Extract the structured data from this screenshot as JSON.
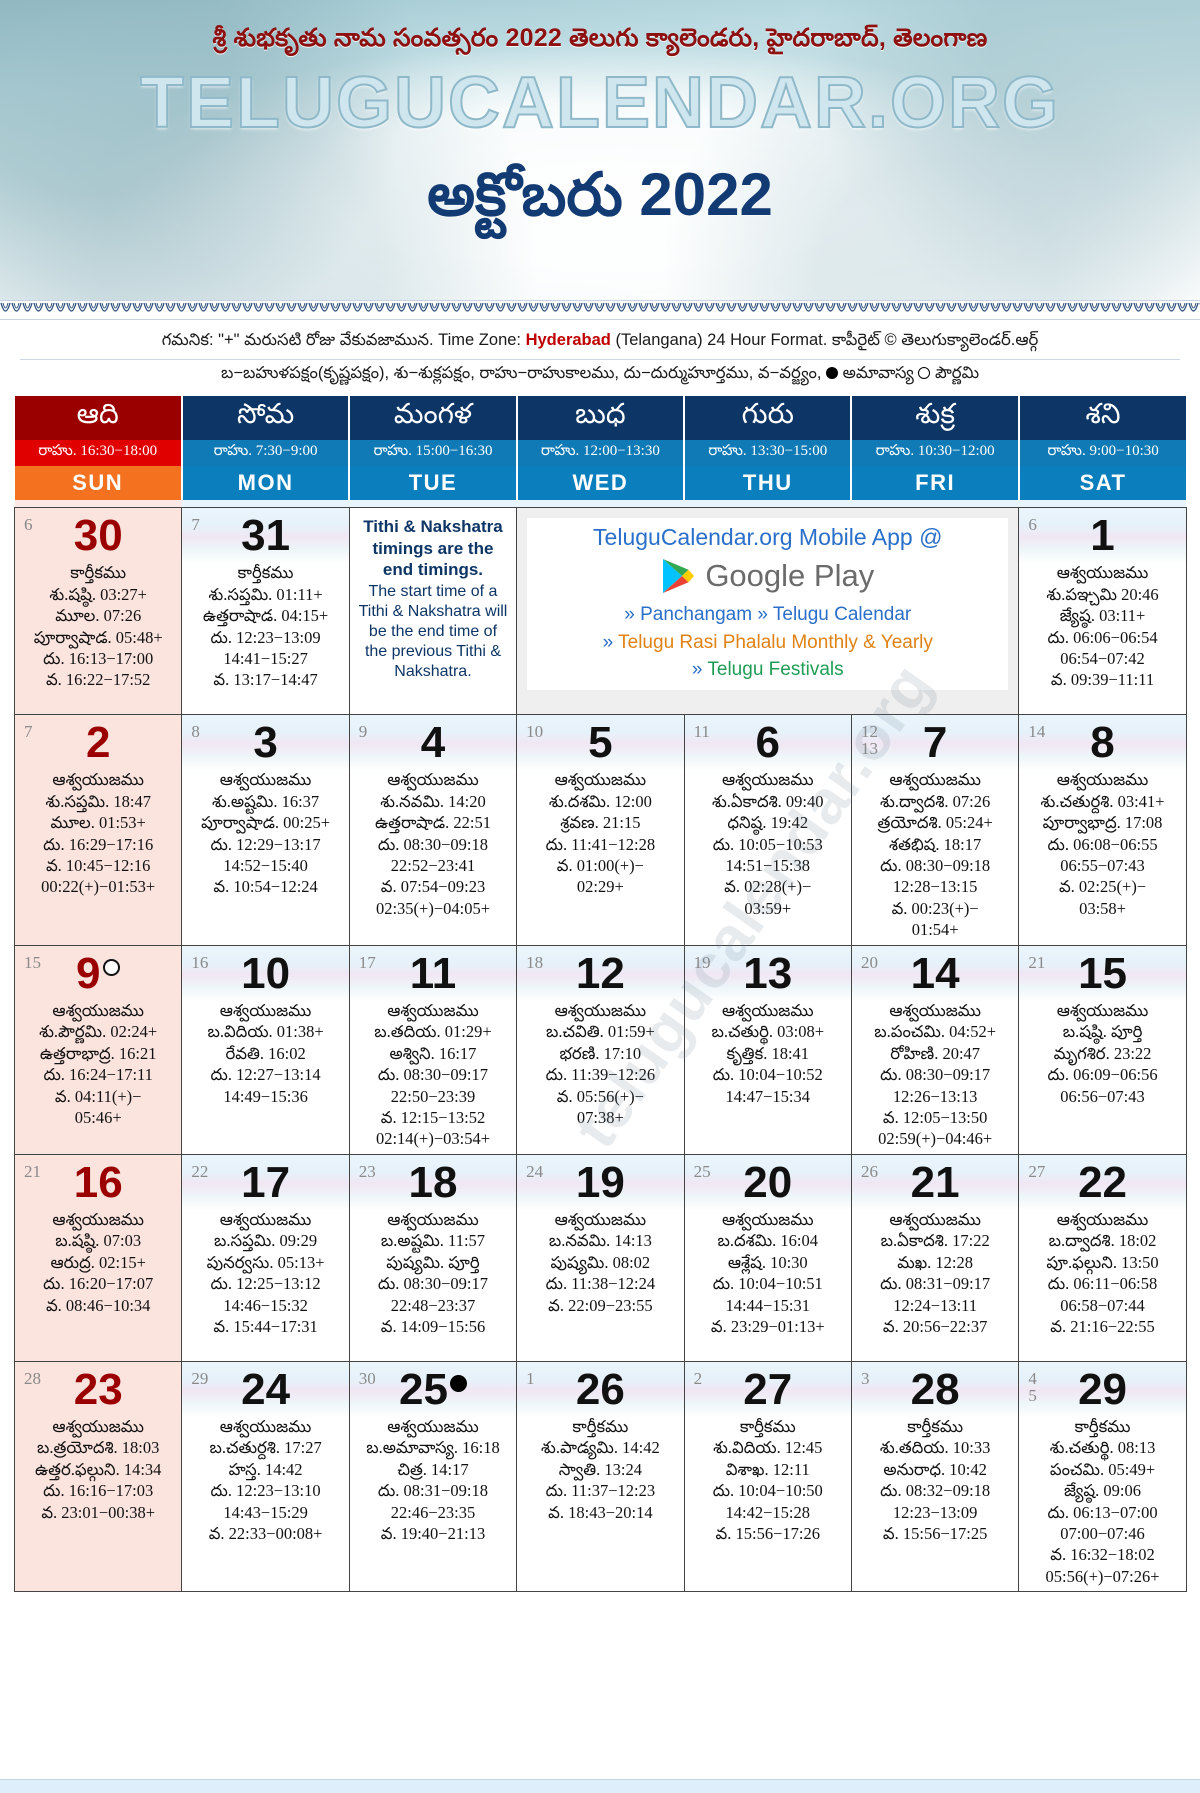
{
  "header": {
    "title": "శ్రీ శుభకృతు నామ సంవత్సరం 2022 తెలుగు క్యాలెండరు, హైదరాబాద్, తెలంగాణ",
    "logo": "TELUGUCALENDAR.ORG",
    "month_title": "అక్టోబరు 2022"
  },
  "notes": {
    "prefix": "గమనిక: \"+\" మరుసటి రోజు వేకువజామున.  Time Zone: ",
    "timezone": "Hyderabad",
    "suffix": " (Telangana) 24 Hour Format. కాపీరైట్ © తెలుగుక్యాలెండర్.ఆర్గ్",
    "legend_a": "బ−బహుళపక్షం(కృష్ణపక్షం),  శు−శుక్లపక్షం,  రాహు−రాహుకాలము,  దు−దుర్ముహూర్తము,  వ−వర్జ్యం, ",
    "legend_amavasya": " అమావాస్య ",
    "legend_pournami": " పౌర్ణమి"
  },
  "weekdays": [
    {
      "te": "ఆది",
      "rahu": "రాహు. 16:30−18:00",
      "abbr": "SUN"
    },
    {
      "te": "సోమ",
      "rahu": "రాహు. 7:30−9:00",
      "abbr": "MON"
    },
    {
      "te": "మంగళ",
      "rahu": "రాహు. 15:00−16:30",
      "abbr": "TUE"
    },
    {
      "te": "బుధ",
      "rahu": "రాహు. 12:00−13:30",
      "abbr": "WED"
    },
    {
      "te": "గురు",
      "rahu": "రాహు. 13:30−15:00",
      "abbr": "THU"
    },
    {
      "te": "శుక్ర",
      "rahu": "రాహు. 10:30−12:00",
      "abbr": "FRI"
    },
    {
      "te": "శని",
      "rahu": "రాహు. 9:00−10:30",
      "abbr": "SAT"
    }
  ],
  "tithi_note": {
    "bold": "Tithi & Nakshatra timings are the end timings.",
    "regular": "The start time of a Tithi & Nakshatra will be the end time of the previous Tithi & Nakshatra."
  },
  "promo": {
    "title": "TeluguCalendar.org Mobile App @",
    "store": "Google Play",
    "link1": "Panchangam",
    "link2": "Telugu Calendar",
    "link3": "Telugu Rasi Phalalu Monthly & Yearly",
    "link4": "Telugu Festivals",
    "arrow": "»"
  },
  "watermark_text": "telugucalendar.org",
  "calendar": {
    "weeks": [
      [
        {
          "lunar": [
            "6"
          ],
          "day": "30",
          "sunday": true,
          "lines": [
            "కార్తీకము",
            "శు.షష్ఠి. 03:27+",
            "మూల. 07:26",
            "పూర్వాషాడ. 05:48+",
            "దు. 16:13−17:00",
            "వ. 16:22−17:52"
          ]
        },
        {
          "lunar": [
            "7"
          ],
          "day": "31",
          "lines": [
            "కార్తీకము",
            "శు.సప్తమి. 01:11+",
            "ఉత్తరాషాడ. 04:15+",
            "దు. 12:23−13:09",
            "14:41−15:27",
            "వ. 13:17−14:47"
          ]
        },
        {
          "type": "note"
        },
        {
          "type": "promo"
        },
        {
          "type": "skip"
        },
        {
          "type": "skip"
        },
        {
          "lunar": [
            "6"
          ],
          "day": "1",
          "lines": [
            "ఆశ్వయుజము",
            "శు.పఞ్చమి 20:46",
            "జ్యేష్ఠ. 03:11+",
            "దు. 06:06−06:54",
            "06:54−07:42",
            "వ. 09:39−11:11"
          ]
        }
      ],
      [
        {
          "lunar": [
            "7"
          ],
          "day": "2",
          "sunday": true,
          "lines": [
            "ఆశ్వయుజము",
            "శు.సప్తమి. 18:47",
            "మూల. 01:53+",
            "దు. 16:29−17:16",
            "వ. 10:45−12:16",
            "00:22(+)−01:53+"
          ]
        },
        {
          "lunar": [
            "8"
          ],
          "day": "3",
          "lines": [
            "ఆశ్వయుజము",
            "శు.అష్టమి. 16:37",
            "పూర్వాషాడ. 00:25+",
            "దు. 12:29−13:17",
            "14:52−15:40",
            "వ. 10:54−12:24"
          ]
        },
        {
          "lunar": [
            "9"
          ],
          "day": "4",
          "lines": [
            "ఆశ్వయుజము",
            "శు.నవమి. 14:20",
            "ఉత్తరాషాడ. 22:51",
            "దు. 08:30−09:18",
            "22:52−23:41",
            "వ. 07:54−09:23",
            "02:35(+)−04:05+"
          ]
        },
        {
          "lunar": [
            "10"
          ],
          "day": "5",
          "lines": [
            "ఆశ్వయుజము",
            "శు.దశమి. 12:00",
            "శ్రవణ. 21:15",
            "దు. 11:41−12:28",
            "వ. 01:00(+)−",
            "02:29+"
          ]
        },
        {
          "lunar": [
            "11"
          ],
          "day": "6",
          "lines": [
            "ఆశ్వయుజము",
            "శు.ఏకాదశి. 09:40",
            "ధనిష్ఠ. 19:42",
            "దు. 10:05−10:53",
            "14:51−15:38",
            "వ. 02:28(+)−",
            "03:59+"
          ]
        },
        {
          "lunar": [
            "12",
            "13"
          ],
          "day": "7",
          "lines": [
            "ఆశ్వయుజము",
            "శు.ద్వాదశి. 07:26",
            "త్రయోదశి. 05:24+",
            "శతభిష. 18:17",
            "దు. 08:30−09:18",
            "12:28−13:15",
            "వ. 00:23(+)−",
            "01:54+"
          ]
        },
        {
          "lunar": [
            "14"
          ],
          "day": "8",
          "lines": [
            "ఆశ్వయుజము",
            "శు.చతుర్దశి. 03:41+",
            "పూర్వాభాద్ర. 17:08",
            "దు. 06:08−06:55",
            "06:55−07:43",
            "వ. 02:25(+)−",
            "03:58+"
          ]
        }
      ],
      [
        {
          "lunar": [
            "15"
          ],
          "day": "9",
          "sunday": true,
          "moon": "full",
          "lines": [
            "ఆశ్వయుజము",
            "శు.పౌర్ణమి. 02:24+",
            "ఉత్తరాభాద్ర. 16:21",
            "దు. 16:24−17:11",
            "వ. 04:11(+)−",
            "05:46+"
          ]
        },
        {
          "lunar": [
            "16"
          ],
          "day": "10",
          "lines": [
            "ఆశ్వయుజము",
            "బ.విదియ. 01:38+",
            "రేవతి. 16:02",
            "దు. 12:27−13:14",
            "14:49−15:36"
          ]
        },
        {
          "lunar": [
            "17"
          ],
          "day": "11",
          "lines": [
            "ఆశ్వయుజము",
            "బ.తదియ. 01:29+",
            "అశ్విని. 16:17",
            "దు. 08:30−09:17",
            "22:50−23:39",
            "వ. 12:15−13:52",
            "02:14(+)−03:54+"
          ]
        },
        {
          "lunar": [
            "18"
          ],
          "day": "12",
          "lines": [
            "ఆశ్వయుజము",
            "బ.చవితి. 01:59+",
            "భరణి. 17:10",
            "దు. 11:39−12:26",
            "వ. 05:56(+)−",
            "07:38+"
          ]
        },
        {
          "lunar": [
            "19"
          ],
          "day": "13",
          "lines": [
            "ఆశ్వయుజము",
            "బ.చతుర్థి. 03:08+",
            "కృత్తిక. 18:41",
            "దు. 10:04−10:52",
            "14:47−15:34"
          ]
        },
        {
          "lunar": [
            "20"
          ],
          "day": "14",
          "lines": [
            "ఆశ్వయుజము",
            "బ.పంచమి. 04:52+",
            "రోహిణి. 20:47",
            "దు. 08:30−09:17",
            "12:26−13:13",
            "వ. 12:05−13:50",
            "02:59(+)−04:46+"
          ]
        },
        {
          "lunar": [
            "21"
          ],
          "day": "15",
          "lines": [
            "ఆశ్వయుజము",
            "బ.షష్ఠి. పూర్తి",
            "మృగశిర. 23:22",
            "దు. 06:09−06:56",
            "06:56−07:43"
          ]
        }
      ],
      [
        {
          "lunar": [
            "21"
          ],
          "day": "16",
          "sunday": true,
          "lines": [
            "ఆశ్వయుజము",
            "బ.షష్ఠి. 07:03",
            "ఆరుద్ర. 02:15+",
            "దు. 16:20−17:07",
            "వ. 08:46−10:34"
          ]
        },
        {
          "lunar": [
            "22"
          ],
          "day": "17",
          "lines": [
            "ఆశ్వయుజము",
            "బ.సప్తమి. 09:29",
            "పునర్వసు. 05:13+",
            "దు. 12:25−13:12",
            "14:46−15:32",
            "వ. 15:44−17:31"
          ]
        },
        {
          "lunar": [
            "23"
          ],
          "day": "18",
          "lines": [
            "ఆశ్వయుజము",
            "బ.అష్టమి. 11:57",
            "పుష్యమి. పూర్తి",
            "దు. 08:30−09:17",
            "22:48−23:37",
            "వ. 14:09−15:56"
          ]
        },
        {
          "lunar": [
            "24"
          ],
          "day": "19",
          "lines": [
            "ఆశ్వయుజము",
            "బ.నవమి. 14:13",
            "పుష్యమి. 08:02",
            "దు. 11:38−12:24",
            "వ. 22:09−23:55"
          ]
        },
        {
          "lunar": [
            "25"
          ],
          "day": "20",
          "lines": [
            "ఆశ్వయుజము",
            "బ.దశమి. 16:04",
            "ఆశ్లేష. 10:30",
            "దు. 10:04−10:51",
            "14:44−15:31",
            "వ. 23:29−01:13+"
          ]
        },
        {
          "lunar": [
            "26"
          ],
          "day": "21",
          "lines": [
            "ఆశ్వయుజము",
            "బ.ఏకాదశి. 17:22",
            "మఖ. 12:28",
            "దు. 08:31−09:17",
            "12:24−13:11",
            "వ. 20:56−22:37"
          ]
        },
        {
          "lunar": [
            "27"
          ],
          "day": "22",
          "lines": [
            "ఆశ్వయుజము",
            "బ.ద్వాదశి. 18:02",
            "పూ.ఫల్గుని. 13:50",
            "దు. 06:11−06:58",
            "06:58−07:44",
            "వ. 21:16−22:55"
          ]
        }
      ],
      [
        {
          "lunar": [
            "28"
          ],
          "day": "23",
          "sunday": true,
          "lines": [
            "ఆశ్వయుజము",
            "బ.త్రయోదశి. 18:03",
            "ఉత్తర.ఫల్గుని. 14:34",
            "దు. 16:16−17:03",
            "వ. 23:01−00:38+"
          ]
        },
        {
          "lunar": [
            "29"
          ],
          "day": "24",
          "lines": [
            "ఆశ్వయుజము",
            "బ.చతుర్దశి. 17:27",
            "హస్త. 14:42",
            "దు. 12:23−13:10",
            "14:43−15:29",
            "వ. 22:33−00:08+"
          ]
        },
        {
          "lunar": [
            "30"
          ],
          "day": "25",
          "moon": "new",
          "lines": [
            "ఆశ్వయుజము",
            "బ.అమావాస్య. 16:18",
            "చిత్ర. 14:17",
            "దు. 08:31−09:18",
            "22:46−23:35",
            "వ. 19:40−21:13"
          ]
        },
        {
          "lunar": [
            "1"
          ],
          "day": "26",
          "lines": [
            "కార్తీకము",
            "శు.పాడ్యమి. 14:42",
            "స్వాతి. 13:24",
            "దు. 11:37−12:23",
            "వ. 18:43−20:14"
          ]
        },
        {
          "lunar": [
            "2"
          ],
          "day": "27",
          "lines": [
            "కార్తీకము",
            "శు.విదియ. 12:45",
            "విశాఖ. 12:11",
            "దు. 10:04−10:50",
            "14:42−15:28",
            "వ. 15:56−17:26"
          ]
        },
        {
          "lunar": [
            "3"
          ],
          "day": "28",
          "lines": [
            "కార్తీకము",
            "శు.తదియ. 10:33",
            "అనురాధ. 10:42",
            "దు. 08:32−09:18",
            "12:23−13:09",
            "వ. 15:56−17:25"
          ]
        },
        {
          "lunar": [
            "4",
            "5"
          ],
          "day": "29",
          "lines": [
            "కార్తీకము",
            "శు.చతుర్థి. 08:13",
            "పంచమి. 05:49+",
            "జ్యేష్ఠ. 09:06",
            "దు. 06:13−07:00",
            "07:00−07:46",
            "వ. 16:32−18:02",
            "05:56(+)−07:26+"
          ]
        }
      ]
    ]
  }
}
